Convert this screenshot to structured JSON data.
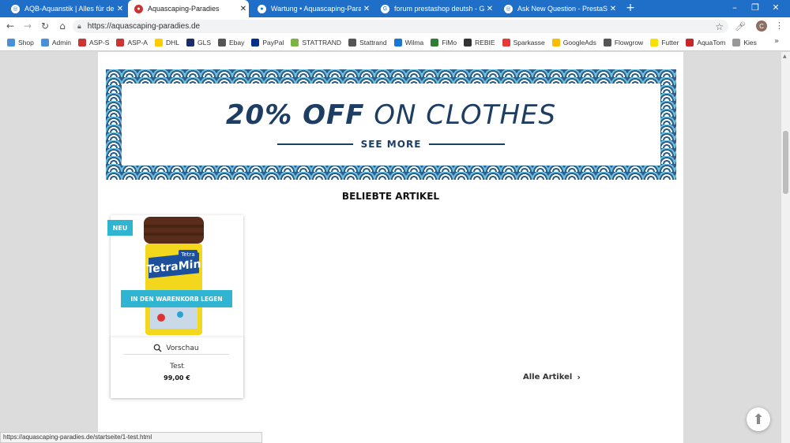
{
  "tabs": [
    {
      "title": "AQB-Aquanstik | Alles für dein A",
      "active": false
    },
    {
      "title": "Aquascaping-Paradies",
      "active": true
    },
    {
      "title": "Wartung • Aquascaping-Paradies",
      "active": false
    },
    {
      "title": "forum prestashop deutsh - Goog",
      "active": false
    },
    {
      "title": "Ask New Question - PrestaShop",
      "active": false
    }
  ],
  "toolbar": {
    "url": "https://aquascaping-paradies.de",
    "profile_initial": "C"
  },
  "bookmarks": [
    {
      "label": "Shop",
      "color": "#4a90d9"
    },
    {
      "label": "Admin",
      "color": "#4a90d9"
    },
    {
      "label": "ASP-S",
      "color": "#c33"
    },
    {
      "label": "ASP-A",
      "color": "#c33"
    },
    {
      "label": "DHL",
      "color": "#ffcc00"
    },
    {
      "label": "GLS",
      "color": "#1b2c6b"
    },
    {
      "label": "Ebay",
      "color": "#555"
    },
    {
      "label": "PayPal",
      "color": "#003087"
    },
    {
      "label": "STATTRAND",
      "color": "#7cb342"
    },
    {
      "label": "Stattrand",
      "color": "#555"
    },
    {
      "label": "Wilma",
      "color": "#1976d2"
    },
    {
      "label": "FiMo",
      "color": "#2e7d32"
    },
    {
      "label": "REBIE",
      "color": "#333"
    },
    {
      "label": "Sparkasse",
      "color": "#e53935"
    },
    {
      "label": "GoogleAds",
      "color": "#fbbc04"
    },
    {
      "label": "Flowgrow",
      "color": "#555"
    },
    {
      "label": "Futter",
      "color": "#f9e000"
    },
    {
      "label": "AquaTom",
      "color": "#c62828"
    },
    {
      "label": "Kies",
      "color": "#999"
    }
  ],
  "banner": {
    "title_bold": "20% OFF",
    "title_rest": "ON CLOTHES",
    "cta": "SEE MORE"
  },
  "section_title": "BELIEBTE ARTIKEL",
  "product": {
    "badge": "NEU",
    "cart_label": "IN DEN WARENKORB LEGEN",
    "quickview_label": "Vorschau",
    "name": "Test",
    "price": "99,00 €",
    "brand": "Tetra",
    "product_line": "TetraMin"
  },
  "all_products_label": "Alle Artikel",
  "status_url": "https://aquascaping-paradies.de/startseite/1-test.html"
}
